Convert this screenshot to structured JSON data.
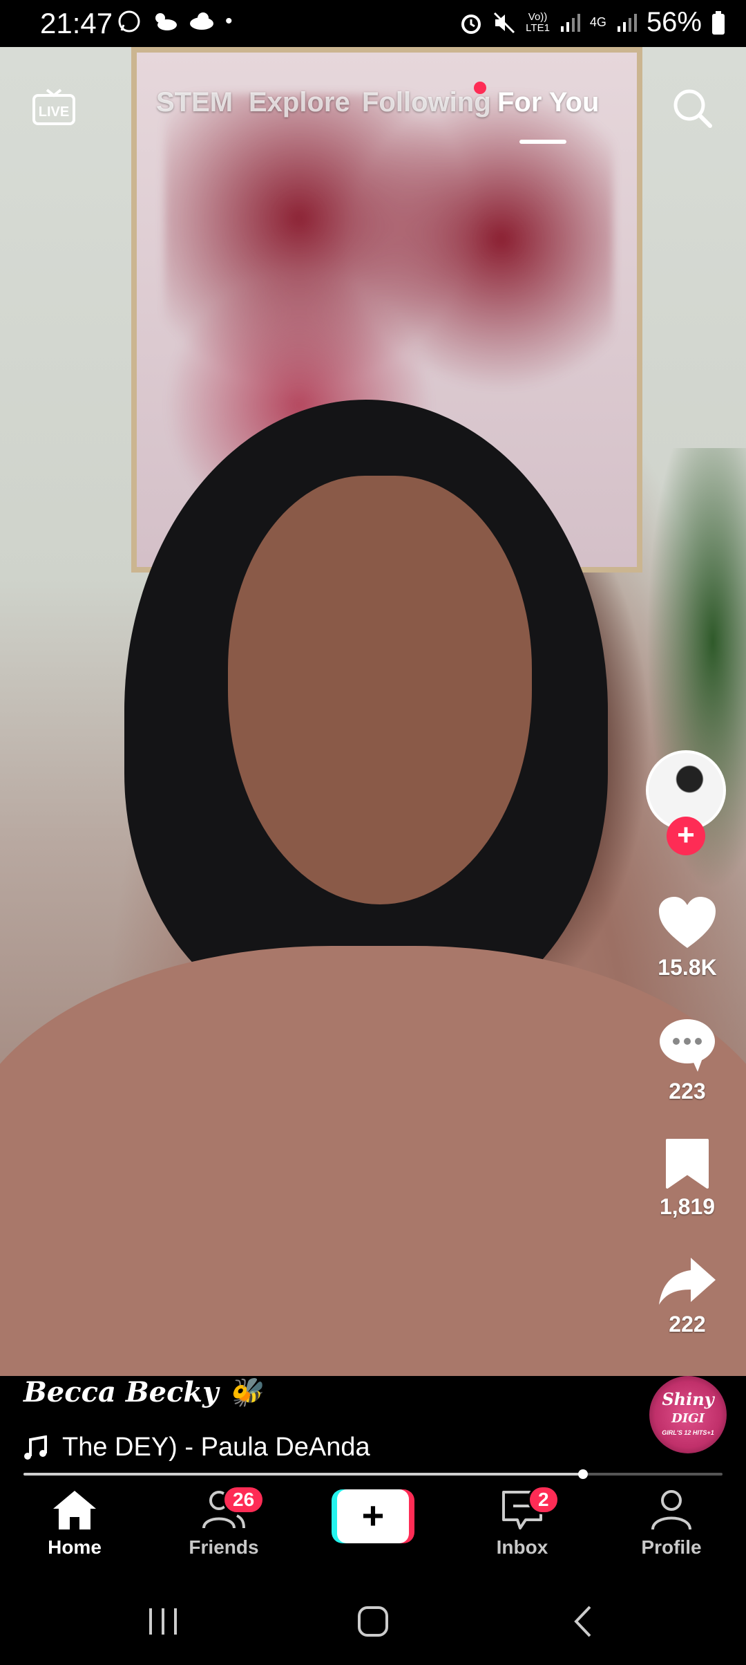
{
  "status_bar": {
    "time": "21:47",
    "network_top": "Vo))",
    "network_bottom": "LTE1",
    "net_type": "4G",
    "battery": "56%"
  },
  "top_nav": {
    "live_label": "LIVE",
    "tabs": [
      {
        "label": "STEM"
      },
      {
        "label": "Explore"
      },
      {
        "label": "Following"
      },
      {
        "label": "For You"
      }
    ],
    "active_tab": "For You"
  },
  "actions": {
    "likes": "15.8K",
    "comments": "223",
    "saves": "1,819",
    "shares": "222"
  },
  "video": {
    "username": "Becca Becky 🐝",
    "music": "The DEY) - Paula DeAnda",
    "sound_disc_line1": "Shiny",
    "sound_disc_line2": "DIGI",
    "sound_disc_line3": "GIRL'S 12 HITS+1",
    "progress": 0.8
  },
  "bottom_nav": {
    "items": [
      {
        "label": "Home"
      },
      {
        "label": "Friends",
        "badge": "26"
      },
      {
        "label": ""
      },
      {
        "label": "Inbox",
        "badge": "2"
      },
      {
        "label": "Profile"
      }
    ]
  },
  "colors": {
    "accent": "#fe2c55",
    "cyan": "#25f4ee",
    "background": "#000000"
  }
}
